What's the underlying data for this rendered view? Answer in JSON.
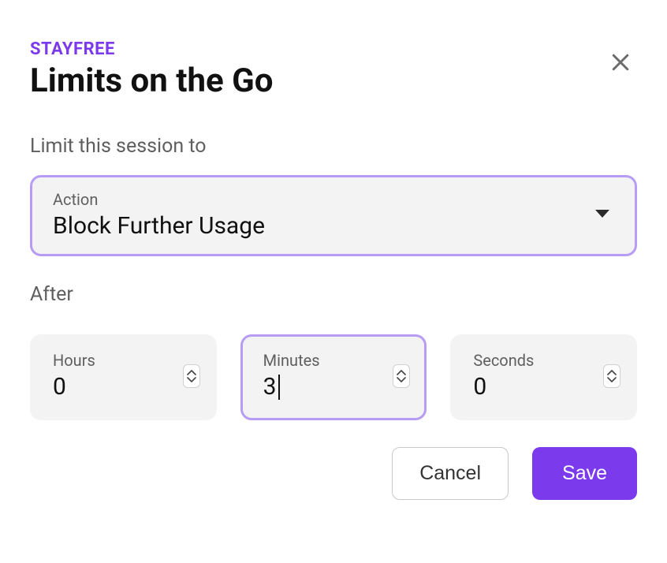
{
  "header": {
    "brand": "STAYFREE",
    "title": "Limits on the Go"
  },
  "session": {
    "label": "Limit this session to",
    "action_label": "Action",
    "action_value": "Block Further Usage"
  },
  "after": {
    "label": "After",
    "hours_label": "Hours",
    "hours_value": "0",
    "minutes_label": "Minutes",
    "minutes_value": "3",
    "seconds_label": "Seconds",
    "seconds_value": "0"
  },
  "buttons": {
    "cancel": "Cancel",
    "save": "Save"
  },
  "colors": {
    "brand": "#7C3AED",
    "focus_border": "#b79cf4"
  }
}
